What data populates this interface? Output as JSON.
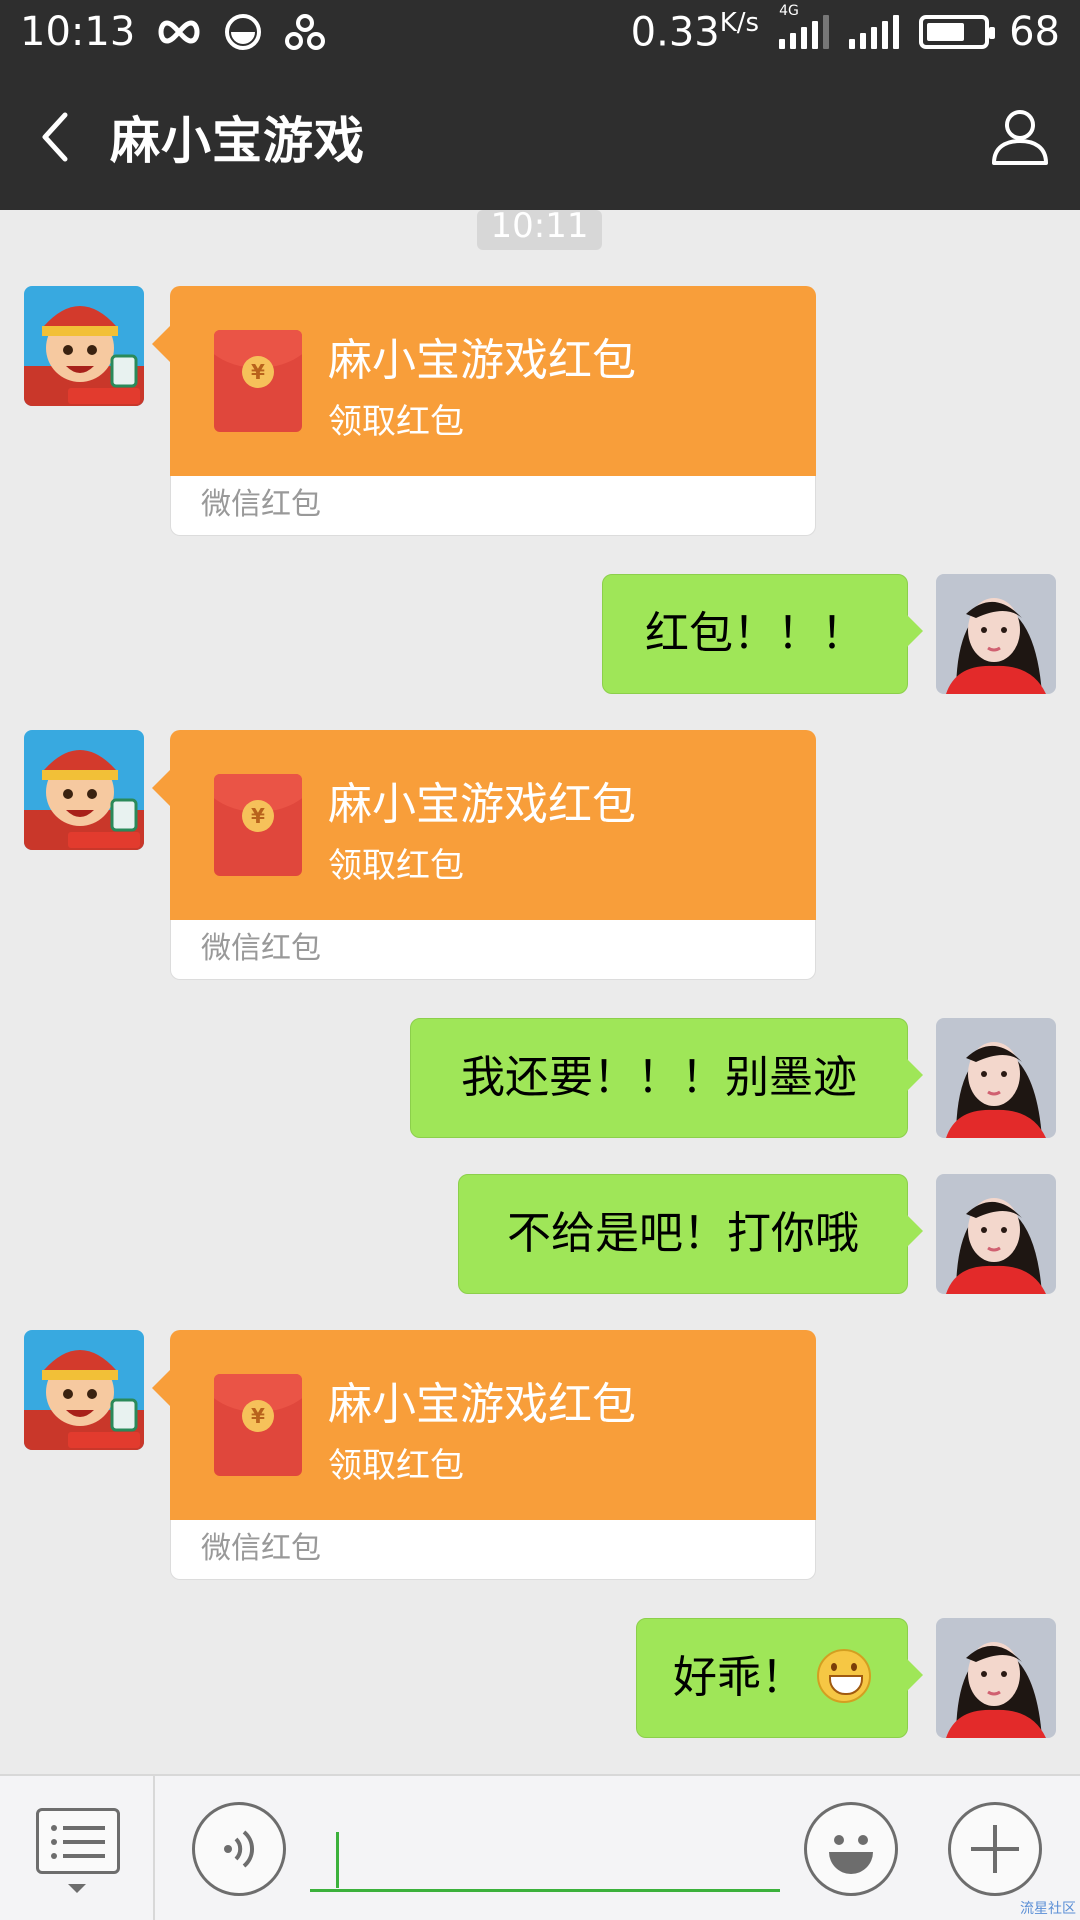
{
  "status_bar": {
    "time": "10:13",
    "net_speed": "0.33",
    "net_unit": "K/s",
    "network_type": "4G",
    "battery": "68",
    "battery_level": 0.68
  },
  "header": {
    "title": "麻小宝游戏",
    "back_icon": "chevron-left-icon",
    "profile_icon": "person-icon"
  },
  "chat": {
    "timestamp": "10:11",
    "red_packet": {
      "title": "麻小宝游戏红包",
      "subtitle": "领取红包",
      "footer": "微信红包"
    },
    "messages": [
      {
        "type": "redpacket"
      },
      {
        "type": "text",
        "text": "红包！！！"
      },
      {
        "type": "redpacket"
      },
      {
        "type": "text",
        "text": "我还要！！！别墨迹"
      },
      {
        "type": "text",
        "text": "不给是吧！打你哦"
      },
      {
        "type": "redpacket"
      },
      {
        "type": "text",
        "text": "好乖！",
        "emoji": "grin-emoji"
      }
    ]
  },
  "input_bar": {
    "menu_icon": "list-menu-icon",
    "voice_icon": "voice-icon",
    "emoji_icon": "smiley-icon",
    "plus_icon": "plus-icon",
    "value": ""
  },
  "colors": {
    "header_bg": "#2e2e2e",
    "chat_bg": "#ebebeb",
    "red_packet": "#f89e3a",
    "sent_bubble": "#9fe658",
    "input_accent": "#3bb13b"
  },
  "watermark": "流星社区"
}
